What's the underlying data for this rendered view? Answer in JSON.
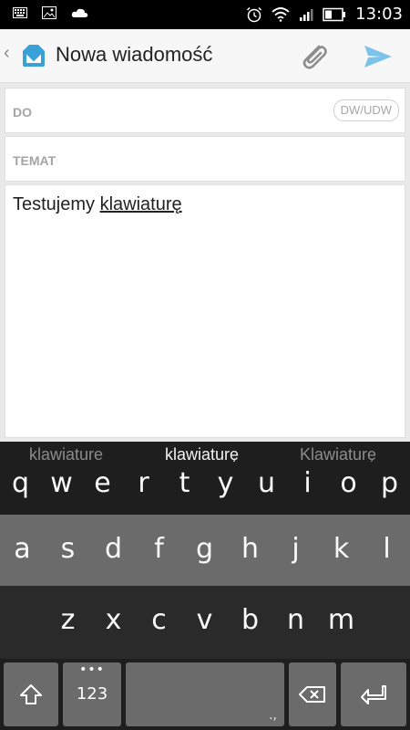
{
  "status_bar": {
    "time": "13:03",
    "left_icons": [
      "keyboard-icon",
      "image-icon",
      "weather-icon"
    ],
    "right_icons": [
      "alarm-icon",
      "wifi-icon",
      "signal-icon",
      "battery-icon"
    ]
  },
  "app_bar": {
    "back_chevron": "‹",
    "title": "Nowa wiadomość",
    "attach_icon": "paperclip-icon",
    "send_icon": "send-icon",
    "accent_color": "#3aa0d8"
  },
  "compose": {
    "to_label": "DO",
    "cc_button": "DW/UDW",
    "subject_label": "TEMAT",
    "body_plain": "Testujemy ",
    "body_underlined": "klawiaturę"
  },
  "keyboard": {
    "suggestions": [
      "klawiature",
      "klawiaturę",
      "Klawiaturę"
    ],
    "row1": [
      "q",
      "w",
      "e",
      "r",
      "t",
      "y",
      "u",
      "i",
      "o",
      "p"
    ],
    "row2": [
      "a",
      "s",
      "d",
      "f",
      "g",
      "h",
      "j",
      "k",
      "l"
    ],
    "row3": [
      "z",
      "x",
      "c",
      "v",
      "b",
      "n",
      "m"
    ],
    "num_key": "123",
    "num_dots": "•••",
    "space_hint": ".,"
  }
}
